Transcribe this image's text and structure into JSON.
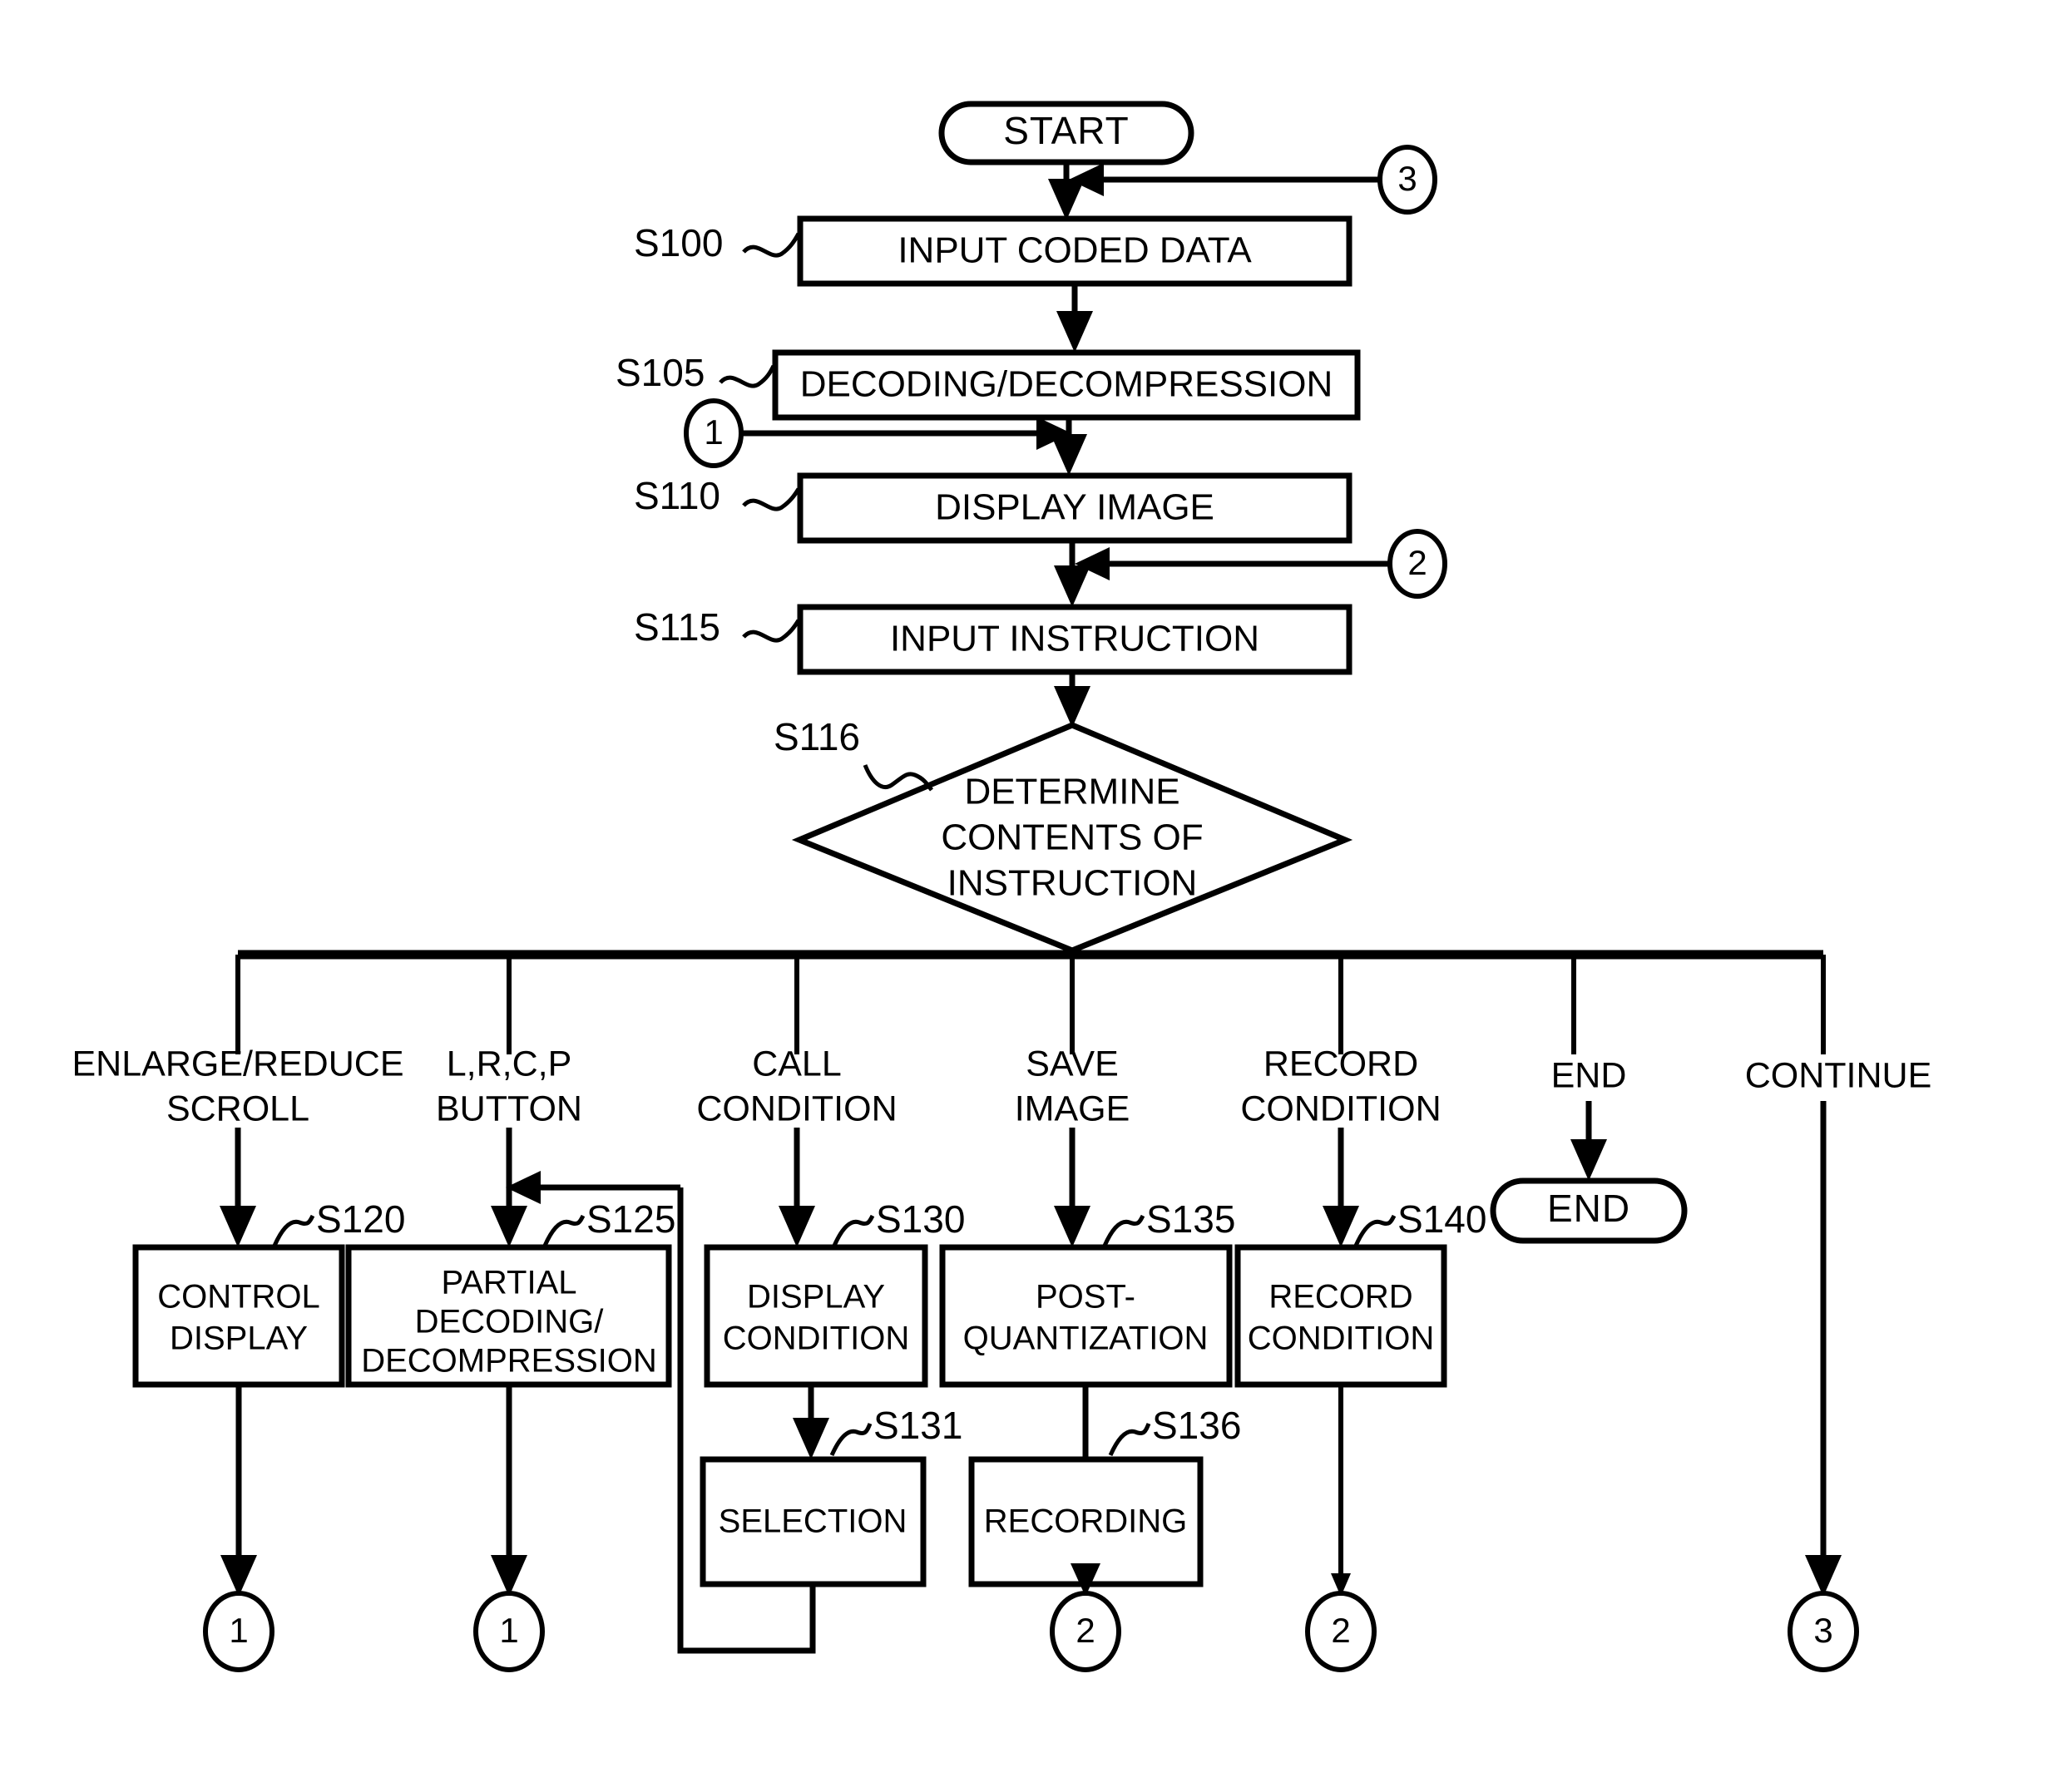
{
  "diagram": {
    "type": "flowchart",
    "title": "",
    "terminators": [
      {
        "id": "start",
        "label": "START"
      },
      {
        "id": "end",
        "label": "END"
      }
    ],
    "process_boxes": [
      {
        "step": "S100",
        "label": "INPUT CODED DATA"
      },
      {
        "step": "S105",
        "label": "DECODING/DECOMPRESSION"
      },
      {
        "step": "S110",
        "label": "DISPLAY IMAGE"
      },
      {
        "step": "S115",
        "label": "INPUT INSTRUCTION"
      },
      {
        "step": "S120",
        "label_line1": "CONTROL",
        "label_line2": "DISPLAY"
      },
      {
        "step": "S125",
        "label_line1": "PARTIAL",
        "label_line2": "DECODING/",
        "label_line3": "DECOMPRESSION"
      },
      {
        "step": "S130",
        "label_line1": "DISPLAY",
        "label_line2": "CONDITION"
      },
      {
        "step": "S131",
        "label_line1": "SELECTION"
      },
      {
        "step": "S135",
        "label_line1": "POST-",
        "label_line2": "QUANTIZATION"
      },
      {
        "step": "S136",
        "label_line1": "RECORDING"
      },
      {
        "step": "S140",
        "label_line1": "RECORD",
        "label_line2": "CONDITION"
      }
    ],
    "decision": {
      "step": "S116",
      "label_line1": "DETERMINE",
      "label_line2": "CONTENTS OF",
      "label_line3": "INSTRUCTION"
    },
    "branches": [
      {
        "index": 1,
        "line1": "ENLARGE/REDUCE",
        "line2": "SCROLL"
      },
      {
        "index": 2,
        "line1": "L,R,C,P",
        "line2": "BUTTON"
      },
      {
        "index": 3,
        "line1": "CALL",
        "line2": "CONDITION"
      },
      {
        "index": 4,
        "line1": "SAVE",
        "line2": "IMAGE"
      },
      {
        "index": 5,
        "line1": "RECORD",
        "line2": "CONDITION"
      },
      {
        "index": 6,
        "line1": "END",
        "line2": ""
      },
      {
        "index": 7,
        "line1": "CONTINUE",
        "line2": ""
      }
    ],
    "connectors": [
      {
        "id": "conn-3-top",
        "label": "3"
      },
      {
        "id": "conn-1-mid",
        "label": "1"
      },
      {
        "id": "conn-2-mid",
        "label": "2"
      },
      {
        "id": "conn-1-a",
        "label": "1"
      },
      {
        "id": "conn-1-b",
        "label": "1"
      },
      {
        "id": "conn-2-a",
        "label": "2"
      },
      {
        "id": "conn-2-b",
        "label": "2"
      },
      {
        "id": "conn-3-bottom",
        "label": "3"
      }
    ],
    "step_labels": [
      "S100",
      "S105",
      "S110",
      "S115",
      "S116",
      "S120",
      "S125",
      "S130",
      "S131",
      "S135",
      "S136",
      "S140"
    ],
    "colors": {
      "stroke": "#000000",
      "fill": "#ffffff",
      "background": "#ffffff"
    }
  }
}
